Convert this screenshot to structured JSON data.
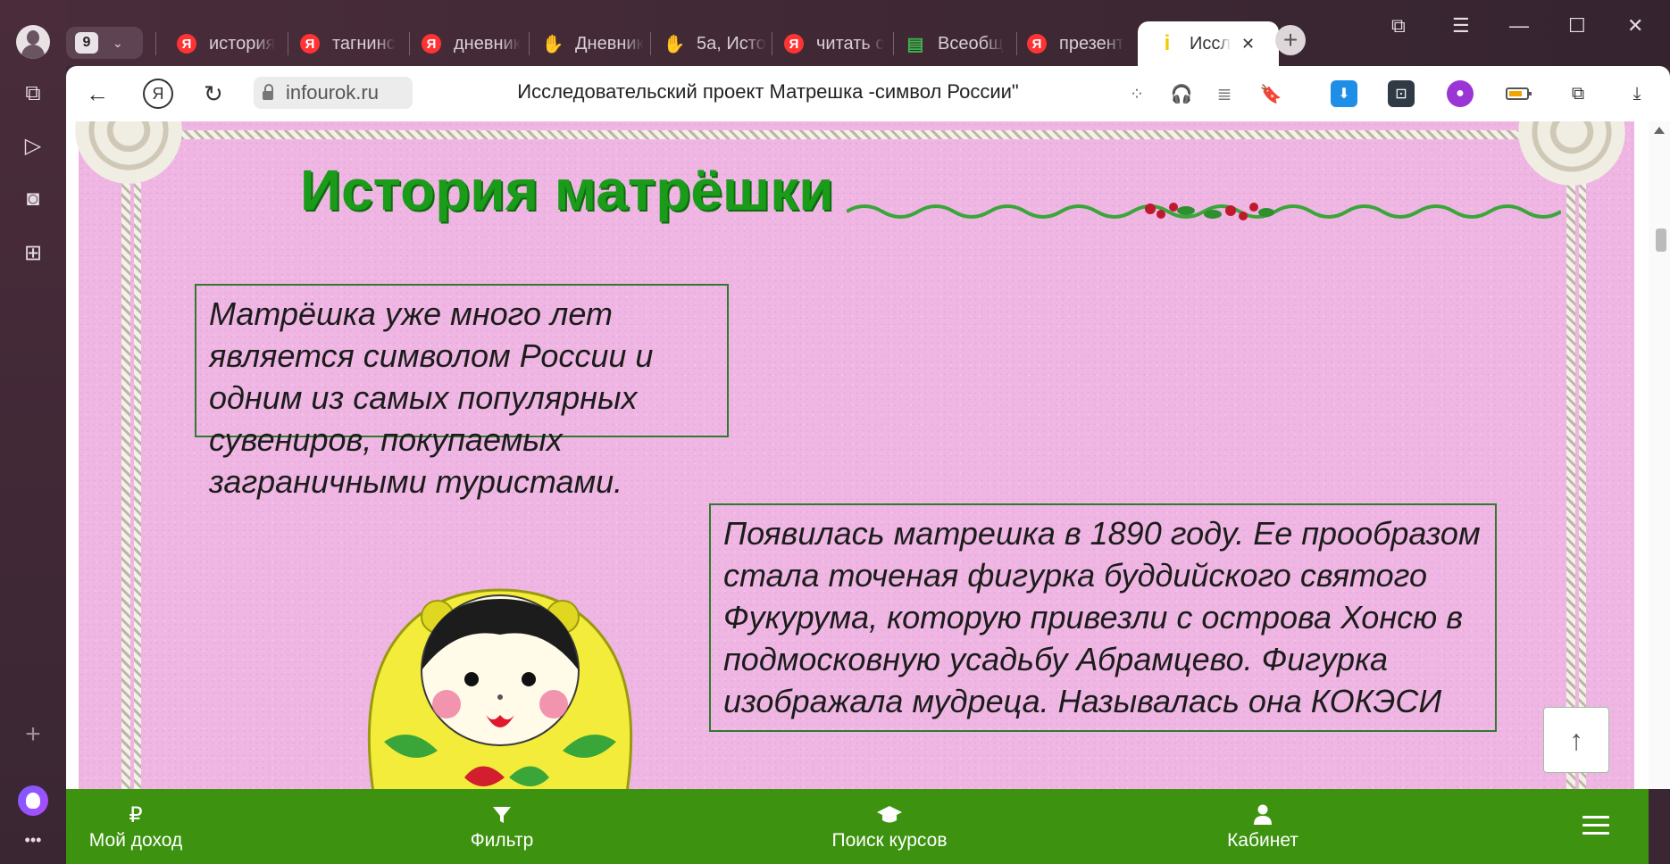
{
  "browser": {
    "tab_count": "9",
    "tabs": [
      {
        "label": "история",
        "icon": "yandex-icon"
      },
      {
        "label": "тагнинс",
        "icon": "yandex-icon"
      },
      {
        "label": "дневник",
        "icon": "yandex-icon"
      },
      {
        "label": "Дневник",
        "icon": "hand-icon"
      },
      {
        "label": "5а, Исто",
        "icon": "hand-icon"
      },
      {
        "label": "читать с",
        "icon": "yandex-icon"
      },
      {
        "label": "Всеобщ",
        "icon": "book-icon"
      },
      {
        "label": "презент",
        "icon": "yandex-icon"
      },
      {
        "label": "Иссл",
        "icon": "infourok-icon",
        "active": true
      }
    ],
    "close_glyph": "✕",
    "address_host": "infourok.ru",
    "page_title": "Исследовательский проект Матрешка -символ России\""
  },
  "slide": {
    "title": "История матрёшки",
    "box1_text": "Матрёшка уже много лет является символом России и одним из самых популярных сувениров, покупаемых заграничными туристами.",
    "box2_text": "Появилась матрешка в 1890 году. Ее прообразом стала точеная фигурка буддийского святого Фукурума, которую привезли с острова Хонсю в подмосковную усадьбу Абрамцево. Фигурка изображала мудреца. Называлась она КОКЭСИ"
  },
  "bottom_nav": {
    "income": "Мой доход",
    "income_icon": "₽",
    "filter": "Фильтр",
    "courses": "Поиск курсов",
    "cabinet": "Кабинет"
  },
  "colors": {
    "accent_green": "#3d930f",
    "title_green": "#1a9b1a",
    "slide_pink": "#efb6e3"
  }
}
